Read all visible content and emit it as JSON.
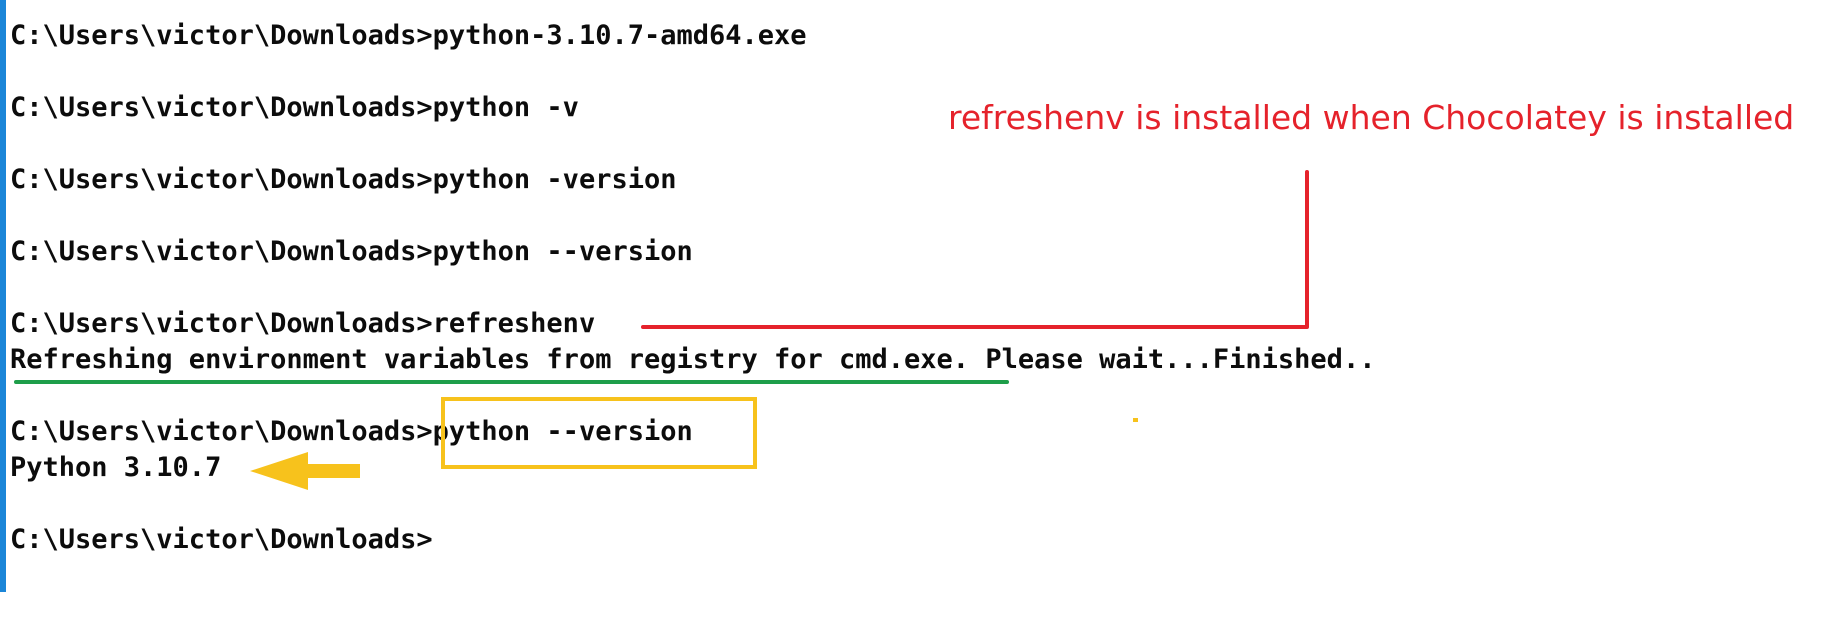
{
  "terminal": {
    "lines": [
      "C:\\Users\\victor\\Downloads>python-3.10.7-amd64.exe",
      "",
      "C:\\Users\\victor\\Downloads>python -v",
      "",
      "C:\\Users\\victor\\Downloads>python -version",
      "",
      "C:\\Users\\victor\\Downloads>python --version",
      "",
      "C:\\Users\\victor\\Downloads>refreshenv",
      "Refreshing environment variables from registry for cmd.exe. Please wait...Finished..",
      "",
      "C:\\Users\\victor\\Downloads>python --version",
      "Python 3.10.7",
      "",
      "C:\\Users\\victor\\Downloads>"
    ]
  },
  "annotation": {
    "text": "refreshenv is installed when Chocolatey is installed"
  },
  "colors": {
    "annotation_red": "#e5222b",
    "underline_green": "#1e9e4a",
    "highlight_yellow": "#f7c21c",
    "border_blue": "#1b86d8"
  }
}
